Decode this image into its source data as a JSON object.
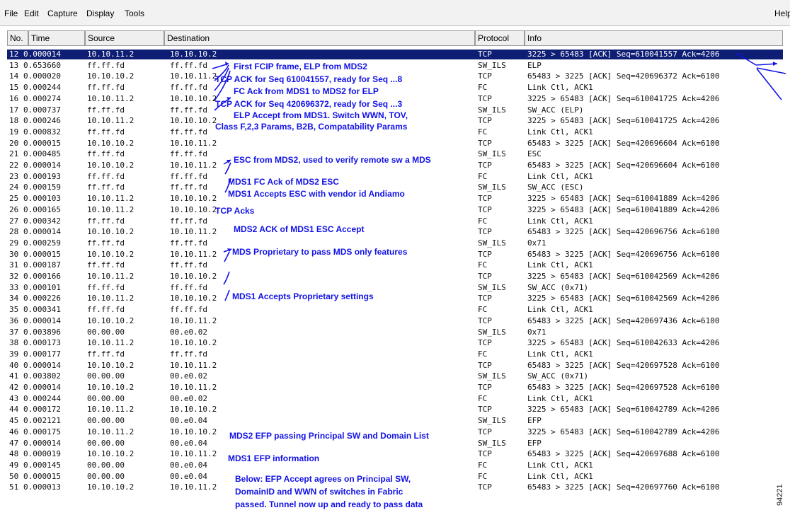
{
  "menu": {
    "file": "File",
    "edit": "Edit",
    "capture": "Capture",
    "display": "Display",
    "tools": "Tools",
    "help": "Help"
  },
  "columns": {
    "no": "No.",
    "time": "Time",
    "source": "Source",
    "destination": "Destination",
    "protocol": "Protocol",
    "info": "Info"
  },
  "packets": [
    {
      "no": "12",
      "time": "0.000014",
      "source": "10.10.11.2",
      "destination": "10.10.10.2",
      "protocol": "TCP",
      "info": "3225 > 65483 [ACK] Seq=610041557 Ack=4206"
    },
    {
      "no": "13",
      "time": "0.653660",
      "source": "ff.ff.fd",
      "destination": "ff.ff.fd",
      "protocol": "SW_ILS",
      "info": "ELP"
    },
    {
      "no": "14",
      "time": "0.000020",
      "source": "10.10.10.2",
      "destination": "10.10.11.2",
      "protocol": "TCP",
      "info": "65483 > 3225 [ACK] Seq=420696372 Ack=6100"
    },
    {
      "no": "15",
      "time": "0.000244",
      "source": "ff.ff.fd",
      "destination": "ff.ff.fd",
      "protocol": "FC",
      "info": "Link Ctl, ACK1"
    },
    {
      "no": "16",
      "time": "0.000274",
      "source": "10.10.11.2",
      "destination": "10.10.10.2",
      "protocol": "TCP",
      "info": "3225 > 65483 [ACK] Seq=610041725 Ack=4206"
    },
    {
      "no": "17",
      "time": "0.000737",
      "source": "ff.ff.fd",
      "destination": "ff.ff.fd",
      "protocol": "SW_ILS",
      "info": "SW_ACC (ELP)"
    },
    {
      "no": "18",
      "time": "0.000246",
      "source": "10.10.11.2",
      "destination": "10.10.10.2",
      "protocol": "TCP",
      "info": "3225 > 65483 [ACK] Seq=610041725 Ack=4206"
    },
    {
      "no": "19",
      "time": "0.000832",
      "source": "ff.ff.fd",
      "destination": "ff.ff.fd",
      "protocol": "FC",
      "info": "Link Ctl, ACK1"
    },
    {
      "no": "20",
      "time": "0.000015",
      "source": "10.10.10.2",
      "destination": "10.10.11.2",
      "protocol": "TCP",
      "info": "65483 > 3225 [ACK] Seq=420696604 Ack=6100"
    },
    {
      "no": "21",
      "time": "0.000485",
      "source": "ff.ff.fd",
      "destination": "ff.ff.fd",
      "protocol": "SW_ILS",
      "info": "ESC"
    },
    {
      "no": "22",
      "time": "0.000014",
      "source": "10.10.10.2",
      "destination": "10.10.11.2",
      "protocol": "TCP",
      "info": "65483 > 3225 [ACK] Seq=420696604 Ack=6100"
    },
    {
      "no": "23",
      "time": "0.000193",
      "source": "ff.ff.fd",
      "destination": "ff.ff.fd",
      "protocol": "FC",
      "info": "Link Ctl, ACK1"
    },
    {
      "no": "24",
      "time": "0.000159",
      "source": "ff.ff.fd",
      "destination": "ff.ff.fd",
      "protocol": "SW_ILS",
      "info": "SW_ACC (ESC)"
    },
    {
      "no": "25",
      "time": "0.000103",
      "source": "10.10.11.2",
      "destination": "10.10.10.2",
      "protocol": "TCP",
      "info": "3225 > 65483 [ACK] Seq=610041889 Ack=4206"
    },
    {
      "no": "26",
      "time": "0.000165",
      "source": "10.10.11.2",
      "destination": "10.10.10.2",
      "protocol": "TCP",
      "info": "3225 > 65483 [ACK] Seq=610041889 Ack=4206"
    },
    {
      "no": "27",
      "time": "0.000342",
      "source": "ff.ff.fd",
      "destination": "ff.ff.fd",
      "protocol": "FC",
      "info": "Link Ctl, ACK1"
    },
    {
      "no": "28",
      "time": "0.000014",
      "source": "10.10.10.2",
      "destination": "10.10.11.2",
      "protocol": "TCP",
      "info": "65483 > 3225 [ACK] Seq=420696756 Ack=6100"
    },
    {
      "no": "29",
      "time": "0.000259",
      "source": "ff.ff.fd",
      "destination": "ff.ff.fd",
      "protocol": "SW_ILS",
      "info": "0x71"
    },
    {
      "no": "30",
      "time": "0.000015",
      "source": "10.10.10.2",
      "destination": "10.10.11.2",
      "protocol": "TCP",
      "info": "65483 > 3225 [ACK] Seq=420696756 Ack=6100"
    },
    {
      "no": "31",
      "time": "0.000187",
      "source": "ff.ff.fd",
      "destination": "ff.ff.fd",
      "protocol": "FC",
      "info": "Link Ctl, ACK1"
    },
    {
      "no": "32",
      "time": "0.000166",
      "source": "10.10.11.2",
      "destination": "10.10.10.2",
      "protocol": "TCP",
      "info": "3225 > 65483 [ACK] Seq=610042569 Ack=4206"
    },
    {
      "no": "33",
      "time": "0.000101",
      "source": "ff.ff.fd",
      "destination": "ff.ff.fd",
      "protocol": "SW_ILS",
      "info": "SW_ACC (0x71)"
    },
    {
      "no": "34",
      "time": "0.000226",
      "source": "10.10.11.2",
      "destination": "10.10.10.2",
      "protocol": "TCP",
      "info": "3225 > 65483 [ACK] Seq=610042569 Ack=4206"
    },
    {
      "no": "35",
      "time": "0.000341",
      "source": "ff.ff.fd",
      "destination": "ff.ff.fd",
      "protocol": "FC",
      "info": "Link Ctl, ACK1"
    },
    {
      "no": "36",
      "time": "0.000014",
      "source": "10.10.10.2",
      "destination": "10.10.11.2",
      "protocol": "TCP",
      "info": "65483 > 3225 [ACK] Seq=420697436 Ack=6100"
    },
    {
      "no": "37",
      "time": "0.003896",
      "source": "00.00.00",
      "destination": "00.e0.02",
      "protocol": "SW_ILS",
      "info": "0x71"
    },
    {
      "no": "38",
      "time": "0.000173",
      "source": "10.10.11.2",
      "destination": "10.10.10.2",
      "protocol": "TCP",
      "info": "3225 > 65483 [ACK] Seq=610042633 Ack=4206"
    },
    {
      "no": "39",
      "time": "0.000177",
      "source": "ff.ff.fd",
      "destination": "ff.ff.fd",
      "protocol": "FC",
      "info": "Link Ctl, ACK1"
    },
    {
      "no": "40",
      "time": "0.000014",
      "source": "10.10.10.2",
      "destination": "10.10.11.2",
      "protocol": "TCP",
      "info": "65483 > 3225 [ACK] Seq=420697528 Ack=6100"
    },
    {
      "no": "41",
      "time": "0.003802",
      "source": "00.00.00",
      "destination": "00.e0.02",
      "protocol": "SW_ILS",
      "info": "SW_ACC (0x71)"
    },
    {
      "no": "42",
      "time": "0.000014",
      "source": "10.10.10.2",
      "destination": "10.10.11.2",
      "protocol": "TCP",
      "info": "65483 > 3225 [ACK] Seq=420697528 Ack=6100"
    },
    {
      "no": "43",
      "time": "0.000244",
      "source": "00.00.00",
      "destination": "00.e0.02",
      "protocol": "FC",
      "info": "Link Ctl, ACK1"
    },
    {
      "no": "44",
      "time": "0.000172",
      "source": "10.10.11.2",
      "destination": "10.10.10.2",
      "protocol": "TCP",
      "info": "3225 > 65483 [ACK] Seq=610042789 Ack=4206"
    },
    {
      "no": "45",
      "time": "0.002121",
      "source": "00.00.00",
      "destination": "00.e0.04",
      "protocol": "SW_ILS",
      "info": "EFP"
    },
    {
      "no": "46",
      "time": "0.000175",
      "source": "10.10.11.2",
      "destination": "10.10.10.2",
      "protocol": "TCP",
      "info": "3225 > 65483 [ACK] Seq=610042789 Ack=4206"
    },
    {
      "no": "47",
      "time": "0.000014",
      "source": "00.00.00",
      "destination": "00.e0.04",
      "protocol": "SW_ILS",
      "info": "EFP"
    },
    {
      "no": "48",
      "time": "0.000019",
      "source": "10.10.10.2",
      "destination": "10.10.11.2",
      "protocol": "TCP",
      "info": "65483 > 3225 [ACK] Seq=420697688 Ack=6100"
    },
    {
      "no": "49",
      "time": "0.000145",
      "source": "00.00.00",
      "destination": "00.e0.04",
      "protocol": "FC",
      "info": "Link Ctl, ACK1"
    },
    {
      "no": "50",
      "time": "0.000015",
      "source": "00.00.00",
      "destination": "00.e0.04",
      "protocol": "FC",
      "info": "Link Ctl, ACK1"
    },
    {
      "no": "51",
      "time": "0.000013",
      "source": "10.10.10.2",
      "destination": "10.10.11.2",
      "protocol": "TCP",
      "info": "65483 > 3225 [ACK] Seq=420697760 Ack=6100"
    }
  ],
  "annotations": {
    "a1": "First FCIP frame, ELP from MDS2",
    "a2": "TCP ACK for Seq 610041557, ready for Seq ...8",
    "a3": "FC Ack from MDS1 to MDS2 for ELP",
    "a4": "TCP ACK for Seq 420696372, ready for Seq ...3",
    "a5": "ELP Accept from MDS1.  Switch WWN, TOV,",
    "a6": "Class F,2,3 Params, B2B, Compatability Params",
    "a7": "ESC from MDS2, used to verify remote sw a MDS",
    "a8": "MDS1 FC Ack of MDS2 ESC",
    "a9": "MDS1 Accepts ESC with vendor id Andiamo",
    "a10": "TCP Acks",
    "a11": "MDS2 ACK of MDS1 ESC Accept",
    "a12": "MDS Proprietary to pass MDS only features",
    "a13": "MDS1 Accepts Proprietary settings",
    "a14": "MDS2 EFP passing Principal SW and Domain List",
    "a15": "MDS1 EFP information",
    "a16": "Below: EFP Accept agrees on Principal SW,",
    "a17": "DomainID and WWN of switches in Fabric",
    "a18": "passed.  Tunnel now up and ready to pass data"
  },
  "figure_id": "94221",
  "colors": {
    "selected_row_bg": "#0e1e74",
    "annotation": "#1212e6"
  }
}
